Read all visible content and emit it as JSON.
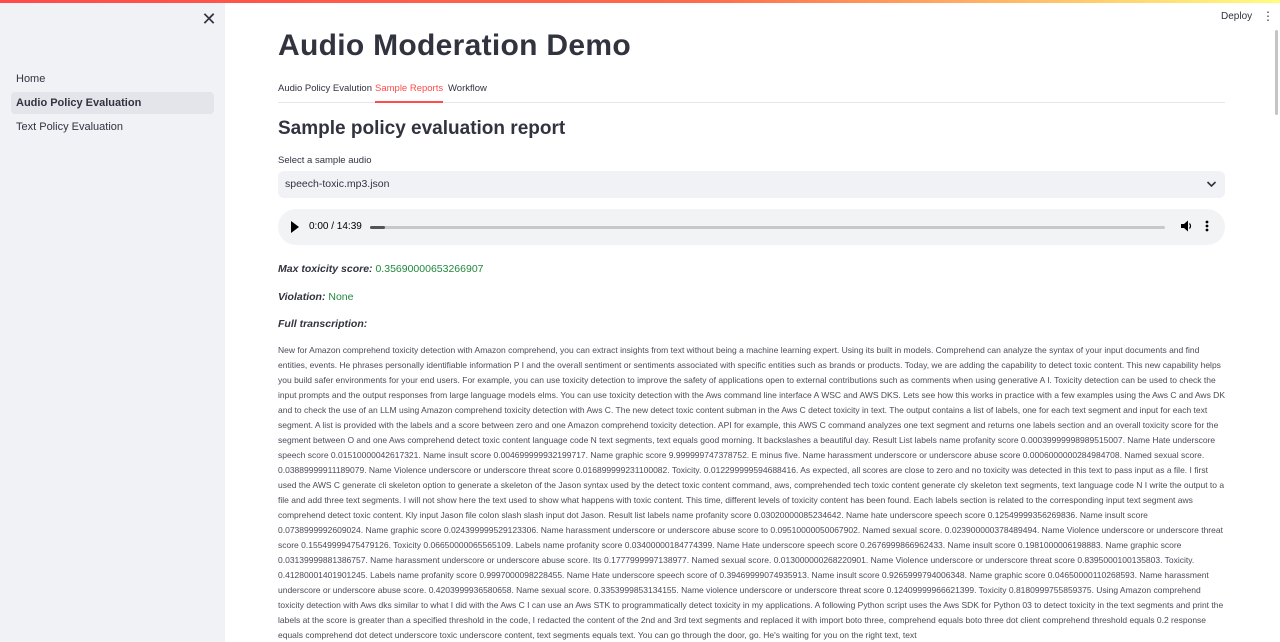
{
  "sidebar": {
    "close_label": "✕",
    "items": [
      {
        "label": "Home",
        "active": false
      },
      {
        "label": "Audio Policy Evaluation",
        "active": true
      },
      {
        "label": "Text Policy Evaluation",
        "active": false
      }
    ]
  },
  "header": {
    "deploy_label": "Deploy",
    "menu_label": "⋮"
  },
  "main": {
    "title": "Audio Moderation Demo",
    "tabs": [
      {
        "label": "Audio Policy Evalution",
        "active": false
      },
      {
        "label": "Sample Reports",
        "active": true
      },
      {
        "label": "Workflow",
        "active": false
      }
    ],
    "subtitle": "Sample policy evaluation report",
    "select_label": "Select a sample audio",
    "select_value": "speech-toxic.mp3.json",
    "player": {
      "time": "0:00 / 14:39",
      "progress_fraction": 0.0
    },
    "max_toxicity_label": "Max toxicity score:",
    "max_toxicity_value": "0.35690000653266907",
    "violation_label": "Violation:",
    "violation_value": "None",
    "transcription_label": "Full transcription:",
    "transcription": "New for Amazon comprehend toxicity detection with Amazon comprehend, you can extract insights from text without being a machine learning expert. Using its built in models. Comprehend can analyze the syntax of your input documents and find entities, events. He phrases personally identifiable information P I and the overall sentiment or sentiments associated with specific entities such as brands or products. Today, we are adding the capability to detect toxic content. This new capability helps you build safer environments for your end users. For example, you can use toxicity detection to improve the safety of applications open to external contributions such as comments when using generative A I. Toxicity detection can be used to check the input prompts and the output responses from large language models elms. You can use toxicity detection with the Aws command line interface A WSC and AWS DKS. Lets see how this works in practice with a few examples using the Aws C and Aws DK and to check the use of an LLM using Amazon comprehend toxicity detection with Aws C. The new detect toxic content subman in the Aws C detect toxicity in text. The output contains a list of labels, one for each text segment and input for each text segment. A list is provided with the labels and a score between zero and one Amazon comprehend toxicity detection. API for example, this AWS C command analyzes one text segment and returns one labels section and an overall toxicity score for the segment between O and one Aws comprehend detect toxic content language code N text segments, text equals good morning. It backslashes a beautiful day. Result List labels name profanity score 0.00039999998989515007. Name Hate underscore speech score 0.01510000042617321. Name insult score 0.004699999932199717. Name graphic score 9.999999747378752. E minus five. Name harassment underscore or underscore abuse score 0.0006000000284984708. Named sexual score. 0.03889999911189079. Name Violence underscore or underscore threat score 0.016899999231100082. Toxicity. 0.012299999594688416. As expected, all scores are close to zero and no toxicity was detected in this text to pass input as a file. I first used the AWS C generate cli skeleton option to generate a skeleton of the Jason syntax used by the detect toxic content command, aws, comprehended tech toxic content generate cly skeleton text segments, text language code N I write the output to a file and add three text segments. I will not show here the text used to show what happens with toxic content. This time, different levels of toxicity content has been found. Each labels section is related to the corresponding input text segment aws comprehend detect toxic content. Kly input Jason file colon slash slash input dot Jason. Result list labels name profanity score 0.03020000085234642. Name hate underscore speech score 0.12549999356269836. Name insult score 0.0738999992609024. Name graphic score 0.024399999529123306. Name harassment underscore or underscore abuse score to 0.09510000050067902. Named sexual score. 0.023900000378489494. Name Violence underscore or underscore threat score 0.15549999475479126. Toxicity 0.06650000065565109. Labels name profanity score 0.03400000184774399. Name Hate underscore speech score 0.2676999866962433. Name insult score 0.1981000006198883. Name graphic score 0.03139999881386757. Name harassment underscore or underscore abuse score. Its 0.1777999997138977. Named sexual score. 0.013000000268220901. Name Violence underscore or underscore threat score 0.8395000100135803. Toxicity. 0.41280001401901245. Labels name profanity score 0.9997000098228455. Name Hate underscore speech score of 0.39469999074935913. Name insult score 0.9265999794006348. Name graphic score 0.04650000110268593. Name harassment underscore or underscore abuse score. 0.4203999936580658. Name sexual score. 0.3353999853134155. Name violence underscore or underscore threat score 0.12409999966621399. Toxicity 0.8180999755859375. Using Amazon comprehend toxicity detection with Aws dks similar to what I did with the Aws C I can use an Aws STK to programmatically detect toxicity in my applications. A following Python script uses the Aws SDK for Python 03 to detect toxicity in the text segments and print the labels at the score is greater than a specified threshold in the code, I redacted the content of the 2nd and 3rd text segments and replaced it with import boto three, comprehend equals boto three dot client comprehend threshold equals 0.2 response equals comprehend dot detect underscore toxic underscore content, text segments equals text. You can go through the door, go. He's waiting for you on the right text, text"
  },
  "colors": {
    "accent": "#ff4b4b",
    "success_text": "#21883b",
    "sidebar_bg": "#f0f2f6"
  },
  "icons": {
    "close": "close-icon",
    "chevron": "chevron-down-icon",
    "play": "play-icon",
    "volume": "volume-icon",
    "more": "more-vertical-icon"
  }
}
